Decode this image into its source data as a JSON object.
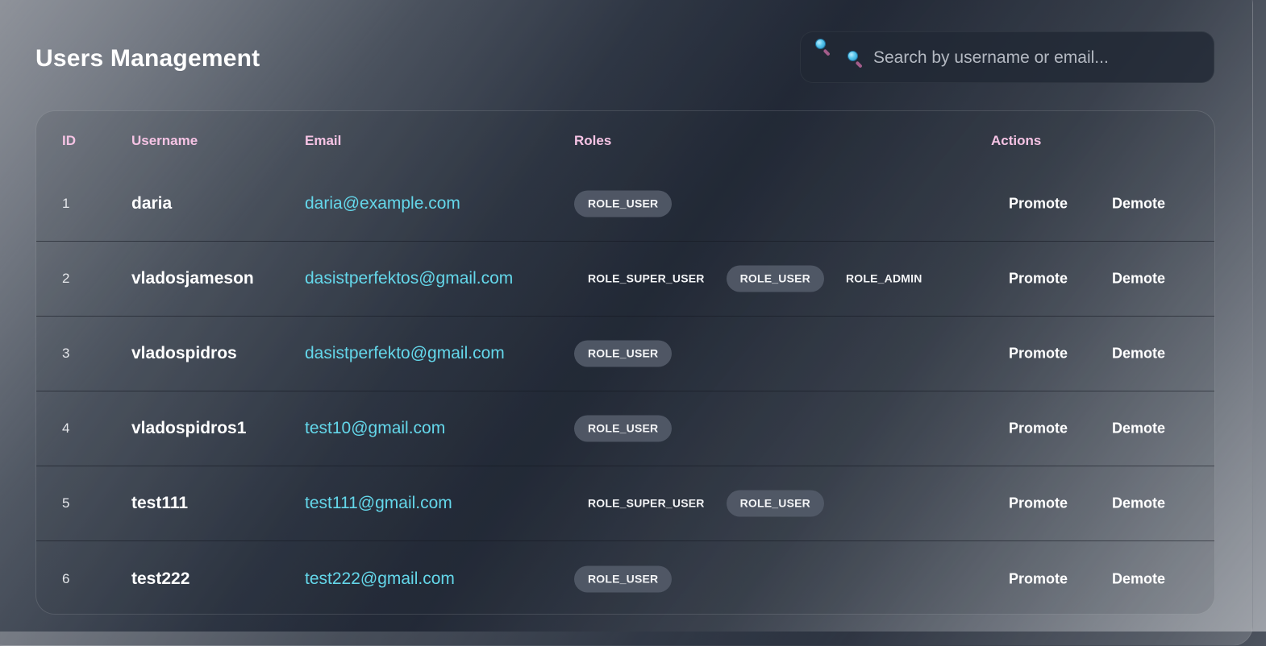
{
  "page": {
    "title": "Users Management"
  },
  "search": {
    "icon_outer": "magnifier-icon",
    "icon_inner": "search-icon",
    "placeholder": "Search by username or email..."
  },
  "table": {
    "columns": [
      "ID",
      "Username",
      "Email",
      "Roles",
      "Actions"
    ],
    "promote_label": "Promote",
    "demote_label": "Demote",
    "rows": [
      {
        "id": "1",
        "username": "daria",
        "email": "daria@example.com",
        "roles": [
          {
            "name": "ROLE_USER",
            "style": "filled"
          }
        ]
      },
      {
        "id": "2",
        "username": "vladosjameson",
        "email": "dasistperfektos@gmail.com",
        "roles": [
          {
            "name": "ROLE_SUPER_USER",
            "style": "plain"
          },
          {
            "name": "ROLE_USER",
            "style": "filled"
          },
          {
            "name": "ROLE_ADMIN",
            "style": "plain"
          }
        ]
      },
      {
        "id": "3",
        "username": "vladospidros",
        "email": "dasistperfekto@gmail.com",
        "roles": [
          {
            "name": "ROLE_USER",
            "style": "filled"
          }
        ]
      },
      {
        "id": "4",
        "username": "vladospidros1",
        "email": "test10@gmail.com",
        "roles": [
          {
            "name": "ROLE_USER",
            "style": "filled"
          }
        ]
      },
      {
        "id": "5",
        "username": "test111",
        "email": "test111@gmail.com",
        "roles": [
          {
            "name": "ROLE_SUPER_USER",
            "style": "plain"
          },
          {
            "name": "ROLE_USER",
            "style": "filled"
          }
        ]
      },
      {
        "id": "6",
        "username": "test222",
        "email": "test222@gmail.com",
        "roles": [
          {
            "name": "ROLE_USER",
            "style": "filled"
          }
        ]
      }
    ]
  },
  "colors": {
    "header_text": "#f5c3e4",
    "email_link": "#64d7ea",
    "chip_bg": "#525a68"
  }
}
